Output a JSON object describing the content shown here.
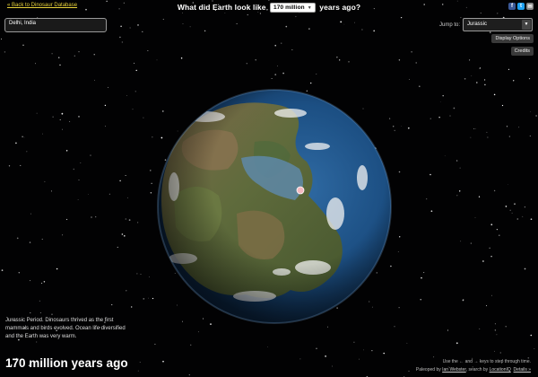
{
  "back_link": "« Back to Dinosaur Database",
  "headline": {
    "before": "What did Earth look like",
    "selected": "170 million",
    "after": "years ago?"
  },
  "social_icons": [
    "facebook-icon",
    "twitter-icon",
    "email-icon"
  ],
  "location_input": {
    "value": "Delhi, India"
  },
  "jump_to": {
    "label": "Jump to:",
    "selected": "Jurassic"
  },
  "buttons": {
    "display_options": "Display Options",
    "credits": "Credits"
  },
  "description": "Jurassic Period. Dinosaurs thrived as the first mammals and birds evolved. Ocean life diversified and the Earth was very warm.",
  "big_title": "170 million years ago",
  "footer": {
    "hint": "Use the ← and → keys to step through time.",
    "built_by_prefix": "Paleoped by",
    "author": "Ian Webster",
    "search_by_prefix": ", search by",
    "search_provider": "LocationIQ",
    "details": "Details »"
  },
  "colors": {
    "link": "#e8d23a",
    "background": "#020203",
    "marker": "#f3b9c0"
  }
}
